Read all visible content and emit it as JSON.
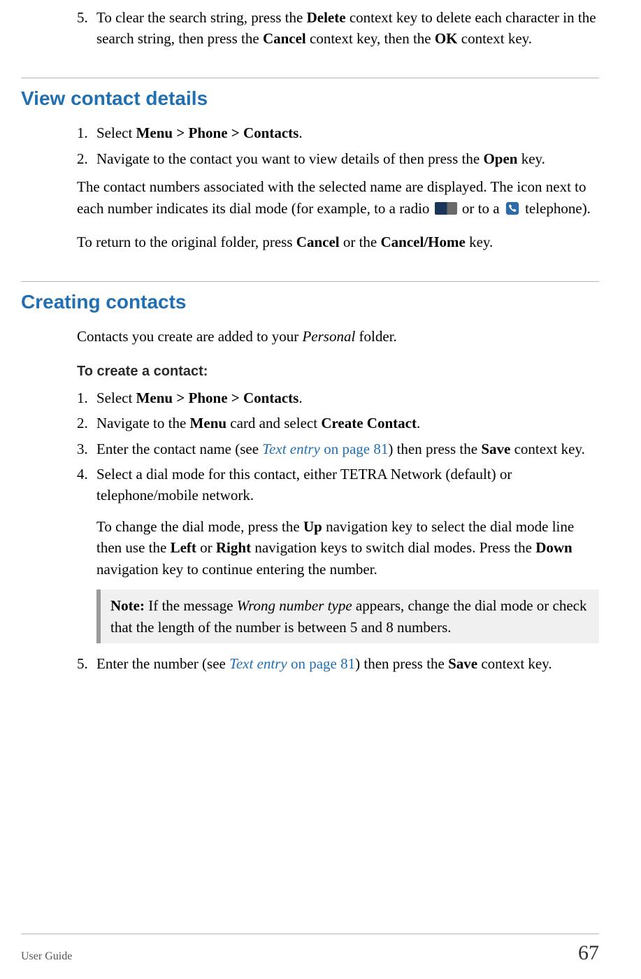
{
  "intro_list": {
    "item5": {
      "num": "5.",
      "pre": "To clear the search string, press the ",
      "b1": "Delete",
      "mid1": " context key to delete each character in the search string, then press the ",
      "b2": "Cancel",
      "mid2": " context key, then the ",
      "b3": "OK",
      "post": " context key."
    }
  },
  "section_view": {
    "heading": "View contact details",
    "item1": {
      "num": "1.",
      "pre": "Select ",
      "b1": "Menu > Phone > Contacts",
      "post": "."
    },
    "item2": {
      "num": "2.",
      "pre": "Navigate to the contact you want to view details of then press the ",
      "b1": "Open",
      "post": " key."
    },
    "para_icons": {
      "pre": "The contact numbers associated with the selected name are displayed. The icon next to each number indicates its dial mode (for example, to a radio ",
      "mid": " or to a ",
      "post": " telephone)."
    },
    "para_return": {
      "pre": "To return to the original folder, press ",
      "b1": "Cancel",
      "mid": " or the ",
      "b2": "Cancel/Home",
      "post": " key."
    }
  },
  "section_create": {
    "heading": "Creating contacts",
    "intro_pre": "Contacts you create are added to your ",
    "intro_it": "Personal",
    "intro_post": " folder.",
    "subhead": "To create a contact:",
    "item1": {
      "num": "1.",
      "pre": "Select ",
      "b1": "Menu > Phone > Contacts",
      "post": "."
    },
    "item2": {
      "num": "2.",
      "pre": "Navigate to the ",
      "b1": "Menu",
      "mid": " card and select ",
      "b2": "Create Contact",
      "post": "."
    },
    "item3": {
      "num": "3.",
      "pre": "Enter the contact name (see ",
      "link": "Text entry",
      "link_post": " on page 81",
      "mid": ") then press the ",
      "b1": "Save",
      "post": " context key."
    },
    "item4": {
      "num": "4.",
      "text": "Select a dial mode for this contact, either TETRA Network (default) or telephone/mobile network."
    },
    "para_dial": {
      "pre": "To change the dial mode, press the ",
      "b1": "Up",
      "mid1": " navigation key to select the dial mode line then use the ",
      "b2": "Left",
      "mid2": " or ",
      "b3": "Right",
      "mid3": " navigation keys to switch dial modes. Press the ",
      "b4": "Down",
      "post": " navigation key to continue entering the number."
    },
    "note": {
      "label": "Note:",
      "pre": "  If the message ",
      "it": "Wrong number type",
      "post": " appears, change the dial mode or check that the length of the number is between 5 and 8 numbers."
    },
    "item5": {
      "num": "5.",
      "pre": "Enter the number (see ",
      "link": "Text entry",
      "link_post": " on page 81",
      "mid": ") then press the ",
      "b1": "Save",
      "post": " context key."
    }
  },
  "footer": {
    "left": "User Guide",
    "right": "67"
  }
}
